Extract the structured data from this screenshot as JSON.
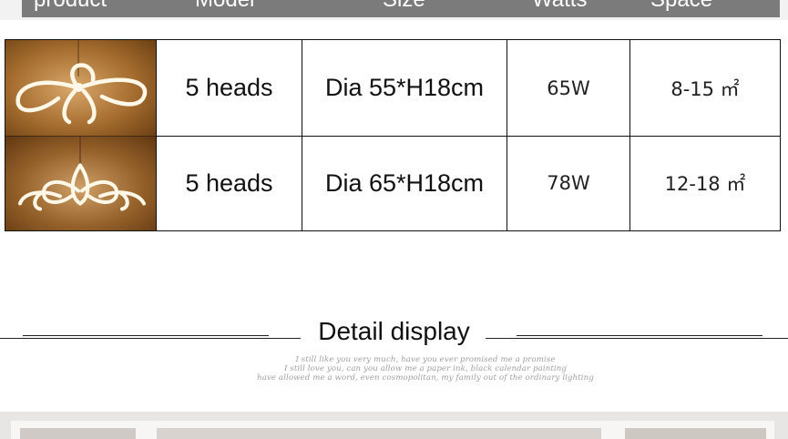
{
  "header": {
    "columns": [
      "product",
      "Model",
      "Size",
      "Watts",
      "Space"
    ]
  },
  "table": {
    "rows": [
      {
        "model": "5 heads",
        "size": "Dia 55*H18cm",
        "watts": "65W",
        "space": "8-15 ㎡"
      },
      {
        "model": "5 heads",
        "size": "Dia 65*H18cm",
        "watts": "78W",
        "space": "12-18 ㎡"
      }
    ]
  },
  "detail": {
    "title": "Detail display",
    "script_lines": [
      "I still like you very much, have you ever promised me a promise",
      "I still love you, can you allow me a paper ink, black calendar painting",
      "have allowed me a word, even cosmopolitan, my family out of the ordinary lighting"
    ]
  },
  "colors": {
    "header_bar": "#7b7b7b",
    "photo_bg": "#8a5a24",
    "lamp_glow": "#fff6e6",
    "border": "#111111",
    "script_text": "#a0a0a0"
  }
}
